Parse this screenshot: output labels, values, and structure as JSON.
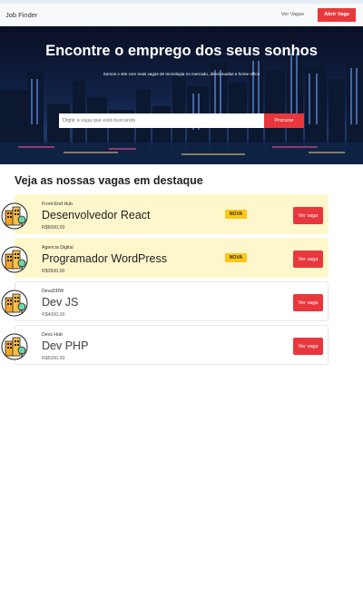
{
  "nav": {
    "brand": "Job Finder",
    "link": "Ver Vagas",
    "cta": "Abrir Vaga"
  },
  "hero": {
    "title": "Encontre o emprego dos seus sonhos",
    "subtitle": "Somos o site com mais vagas de tecnologia no mercado, direcionadas a home office",
    "search_placeholder": "Digite a vaga que está buscando",
    "search_button": "Procurar"
  },
  "section": {
    "title": "Veja as nossas vagas em destaque"
  },
  "jobs": [
    {
      "company": "Front-End Hub",
      "title": "Desenvolvedor React",
      "salary": "R$6000,00",
      "badge": "NOVA",
      "button": "Ver vaga",
      "featured": true
    },
    {
      "company": "Agencia Digital",
      "title": "Programador WordPress",
      "salary": "R$3500,00",
      "badge": "NOVA",
      "button": "Ver vaga",
      "featured": true
    },
    {
      "company": "DevsDDW",
      "title": "Dev JS",
      "salary": "R$4000,00",
      "button": "Ver vaga",
      "featured": false
    },
    {
      "company": "Devs Hub",
      "title": "Dev PHP",
      "salary": "R$5000,00",
      "button": "Ver vaga",
      "featured": false
    }
  ],
  "colors": {
    "accent": "#e8383d",
    "badge": "#ffc61a",
    "featured_bg": "#fff7cc"
  },
  "icons": {
    "company": "office-buildings-icon"
  }
}
